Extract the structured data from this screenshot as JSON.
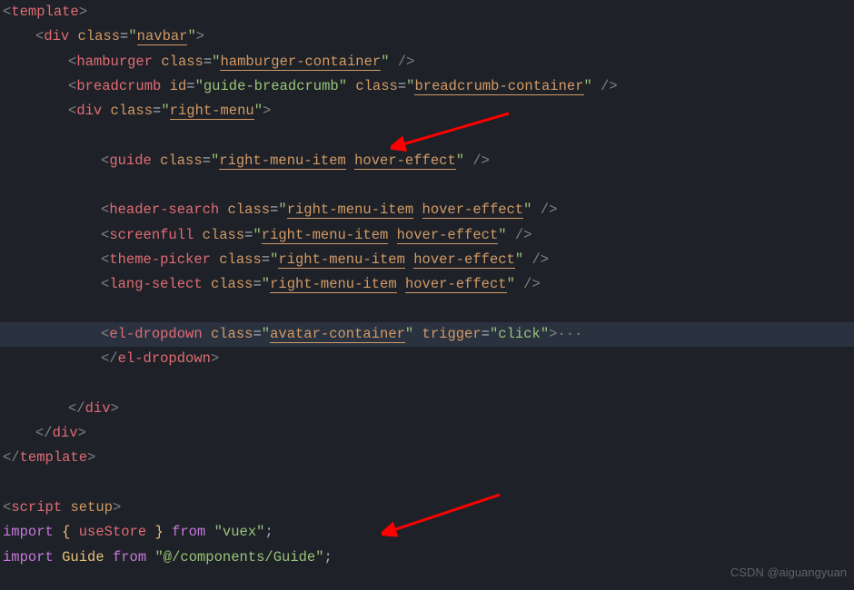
{
  "lines": {
    "l1_open": "<",
    "l1_tag": "template",
    "l1_close": ">",
    "l2_open": "<",
    "l2_tag": "div",
    "l2_sp": " ",
    "l2_attr": "class",
    "l2_eq": "=",
    "l2_q1": "\"",
    "l2_str": "navbar",
    "l2_q2": "\"",
    "l2_close": ">",
    "l3_open": "<",
    "l3_tag": "hamburger",
    "l3_sp": " ",
    "l3_attr": "class",
    "l3_eq": "=",
    "l3_q1": "\"",
    "l3_str": "hamburger-container",
    "l3_q2": "\"",
    "l3_close": " />",
    "l4_open": "<",
    "l4_tag": "breadcrumb",
    "l4_sp": " ",
    "l4_attr1": "id",
    "l4_eq1": "=",
    "l4_q1": "\"",
    "l4_str1": "guide-breadcrumb",
    "l4_q2": "\"",
    "l4_sp2": " ",
    "l4_attr2": "class",
    "l4_eq2": "=",
    "l4_q3": "\"",
    "l4_str2": "breadcrumb-container",
    "l4_q4": "\"",
    "l4_close": " />",
    "l5_open": "<",
    "l5_tag": "div",
    "l5_sp": " ",
    "l5_attr": "class",
    "l5_eq": "=",
    "l5_q1": "\"",
    "l5_str": "right-menu",
    "l5_q2": "\"",
    "l5_close": ">",
    "l7_open": "<",
    "l7_tag": "guide",
    "l7_sp": " ",
    "l7_attr": "class",
    "l7_eq": "=",
    "l7_q1": "\"",
    "l7_str1": "right-menu-item",
    "l7_strsp": " ",
    "l7_str2": "hover-effect",
    "l7_q2": "\"",
    "l7_close": " />",
    "l9_open": "<",
    "l9_tag": "header-search",
    "l9_sp": " ",
    "l9_attr": "class",
    "l9_eq": "=",
    "l9_q1": "\"",
    "l9_str1": "right-menu-item",
    "l9_strsp": " ",
    "l9_str2": "hover-effect",
    "l9_q2": "\"",
    "l9_close": " />",
    "l10_open": "<",
    "l10_tag": "screenfull",
    "l10_sp": " ",
    "l10_attr": "class",
    "l10_eq": "=",
    "l10_q1": "\"",
    "l10_str1": "right-menu-item",
    "l10_strsp": " ",
    "l10_str2": "hover-effect",
    "l10_q2": "\"",
    "l10_close": " />",
    "l11_open": "<",
    "l11_tag": "theme-picker",
    "l11_sp": " ",
    "l11_attr": "class",
    "l11_eq": "=",
    "l11_q1": "\"",
    "l11_str1": "right-menu-item",
    "l11_strsp": " ",
    "l11_str2": "hover-effect",
    "l11_q2": "\"",
    "l11_close": " />",
    "l12_open": "<",
    "l12_tag": "lang-select",
    "l12_sp": " ",
    "l12_attr": "class",
    "l12_eq": "=",
    "l12_q1": "\"",
    "l12_str1": "right-menu-item",
    "l12_strsp": " ",
    "l12_str2": "hover-effect",
    "l12_q2": "\"",
    "l12_close": " />",
    "l14_open": "<",
    "l14_tag": "el-dropdown",
    "l14_sp": " ",
    "l14_attr1": "class",
    "l14_eq1": "=",
    "l14_q1": "\"",
    "l14_str1": "avatar-container",
    "l14_q2": "\"",
    "l14_sp2": " ",
    "l14_attr2": "trigger",
    "l14_eq2": "=",
    "l14_q3": "\"",
    "l14_str2": "click",
    "l14_q4": "\"",
    "l14_close": ">",
    "l14_ell": "···",
    "l15_open": "</",
    "l15_tag": "el-dropdown",
    "l15_close": ">",
    "l17_open": "</",
    "l17_tag": "div",
    "l17_close": ">",
    "l18_open": "</",
    "l18_tag": "div",
    "l18_close": ">",
    "l19_open": "</",
    "l19_tag": "template",
    "l19_close": ">",
    "l21_open": "<",
    "l21_tag": "script",
    "l21_sp": " ",
    "l21_setup": "setup",
    "l21_close": ">",
    "l22_imp": "import",
    "l22_sp1": " ",
    "l22_b1": "{ ",
    "l22_ident": "useStore",
    "l22_b2": " }",
    "l22_sp2": " ",
    "l22_from": "from",
    "l22_sp3": " ",
    "l22_q1": "\"",
    "l22_str": "vuex",
    "l22_q2": "\"",
    "l22_semi": ";",
    "l23_imp": "import",
    "l23_sp1": " ",
    "l23_ident": "Guide",
    "l23_sp2": " ",
    "l23_from": "from",
    "l23_sp3": " ",
    "l23_q1": "\"",
    "l23_str": "@/components/Guide",
    "l23_q2": "\"",
    "l23_semi": ";"
  },
  "watermark": "CSDN @aiguangyuan"
}
